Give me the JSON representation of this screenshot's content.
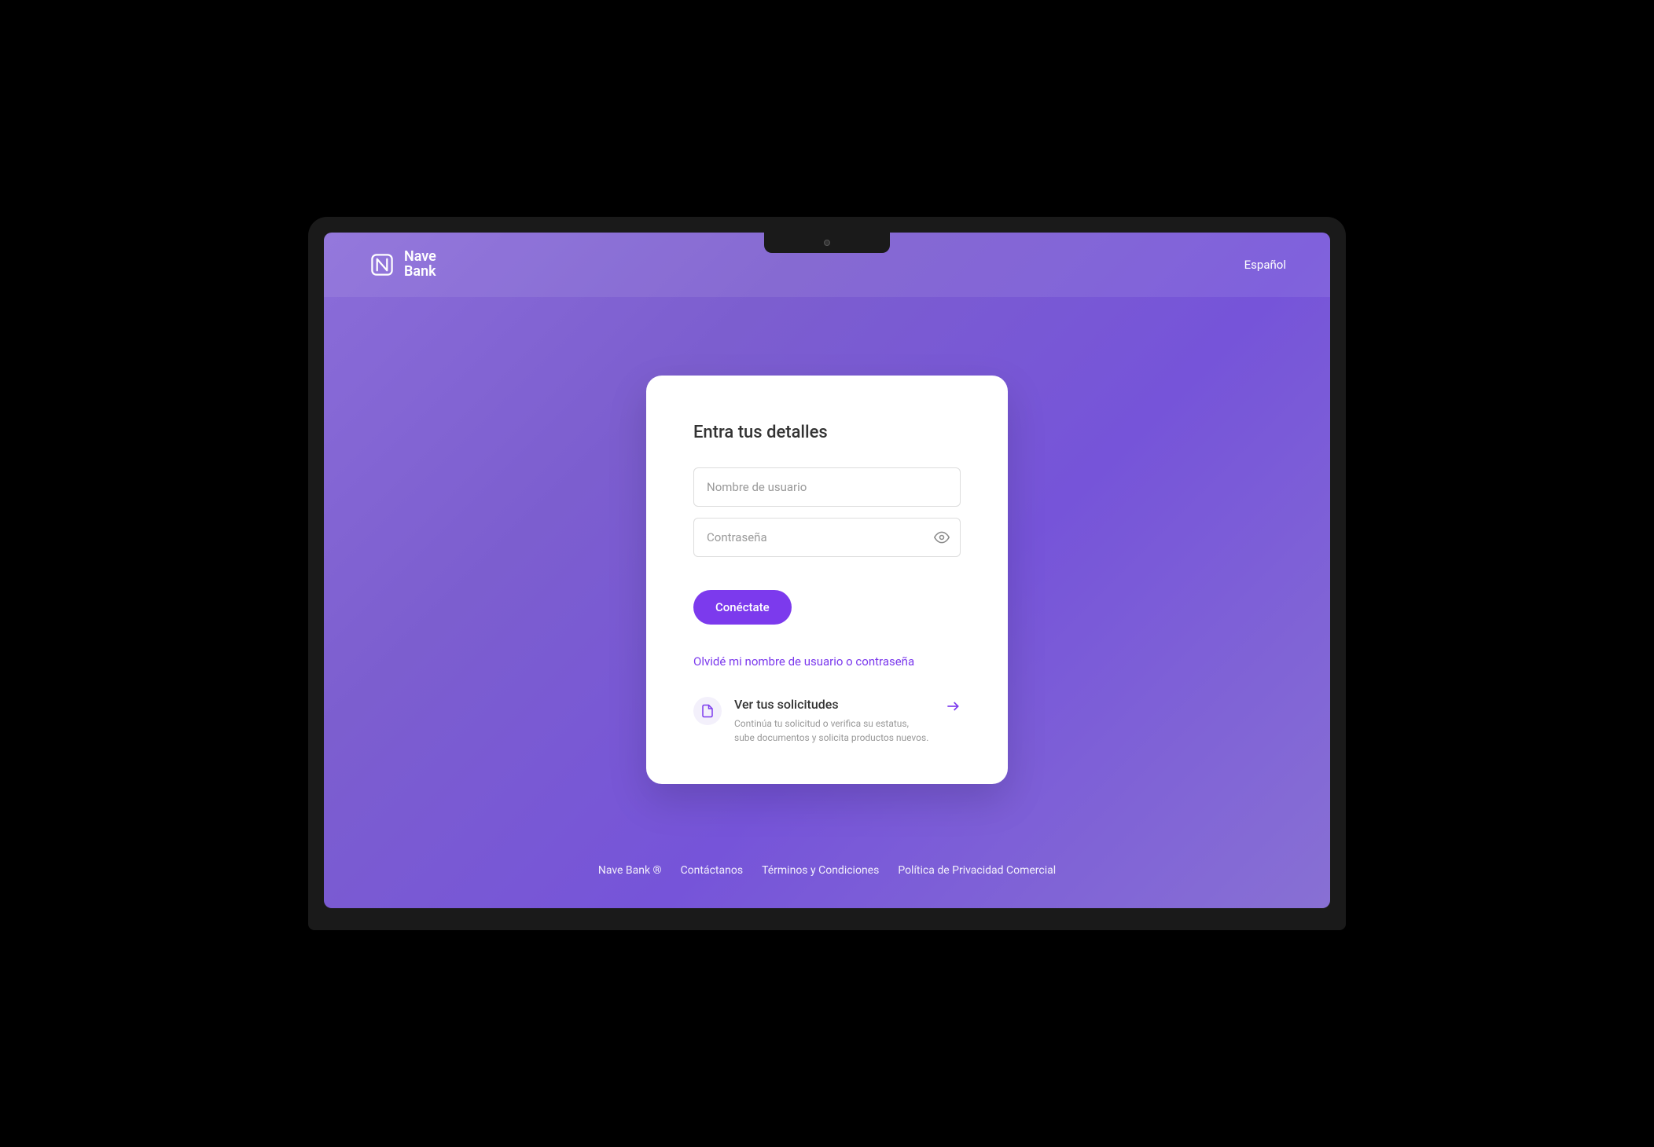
{
  "header": {
    "brand_line1": "Nave",
    "brand_line2": "Bank",
    "language": "Español"
  },
  "login": {
    "title": "Entra tus detalles",
    "username_placeholder": "Nombre de usuario",
    "password_placeholder": "Contraseña",
    "submit_label": "Conéctate",
    "forgot_link": "Olvidé mi nombre de usuario o contraseña"
  },
  "requests": {
    "title": "Ver tus solicitudes",
    "description_line1": "Continúa tu solicitud o verifica su estatus,",
    "description_line2": "sube documentos y solicita productos nuevos."
  },
  "footer": {
    "brand": "Nave Bank ®",
    "contact": "Contáctanos",
    "terms": "Términos y Condiciones",
    "privacy": "Política de Privacidad Comercial"
  }
}
